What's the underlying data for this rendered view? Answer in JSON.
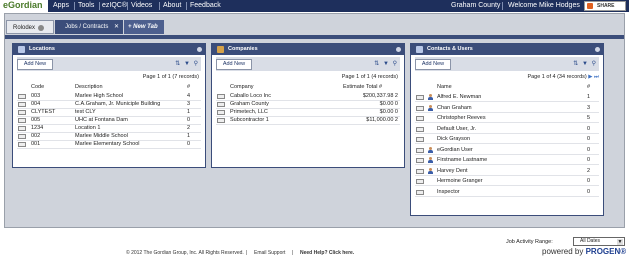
{
  "app": {
    "logo": "eGordian"
  },
  "nav": {
    "items": [
      "Apps",
      "Tools",
      "ezIQC®",
      "Videos",
      "About",
      "Feedback"
    ],
    "county": "Graham County",
    "welcome": "Welcome Mike Hodges",
    "share": "SHARE"
  },
  "tabs": {
    "rolodex": "Rolodex",
    "jobs": "Jobs / Contracts",
    "new_tab": "New Tab"
  },
  "locations": {
    "title": "Locations",
    "add_label": "Add New",
    "pager": "Page 1 of 1 (7 records)",
    "columns": [
      "Code",
      "Description",
      "#"
    ],
    "rows": [
      {
        "code": "003",
        "desc": "Marlee High School",
        "count": "4"
      },
      {
        "code": "004",
        "desc": "C.A.Graham, Jr. Municiple Building",
        "count": "3"
      },
      {
        "code": "CLYTEST",
        "desc": "test CLY",
        "count": "1"
      },
      {
        "code": "005",
        "desc": "UHC at Fontana Dam",
        "count": "0"
      },
      {
        "code": "1234",
        "desc": "Location 1",
        "count": "2"
      },
      {
        "code": "002",
        "desc": "Marlee Middle School",
        "count": "1"
      },
      {
        "code": "001",
        "desc": "Marlee Elementary School",
        "count": "0"
      }
    ]
  },
  "companies": {
    "title": "Companies",
    "add_label": "Add New",
    "pager": "Page 1 of 1 (4 records)",
    "columns": [
      "Company",
      "Estimate Total #"
    ],
    "rows": [
      {
        "name": "Caballo Loco Inc",
        "total": "$200,337.98 2"
      },
      {
        "name": "Graham County",
        "total": "$0.00 0"
      },
      {
        "name": "Primetech, LLC",
        "total": "$0.00 0"
      },
      {
        "name": "Subcontractor 1",
        "total": "$11,000.00 2"
      }
    ]
  },
  "contacts": {
    "title": "Contacts & Users",
    "add_label": "Add New",
    "pager": "Page 1 of 4 (34 records)",
    "columns": [
      "Name",
      "#"
    ],
    "rows": [
      {
        "name": "Alfred E. Newman",
        "count": "1",
        "person": true
      },
      {
        "name": "Chan Graham",
        "count": "3",
        "person": true
      },
      {
        "name": "Christopher Reeves",
        "count": "5",
        "person": false
      },
      {
        "name": "Default User, Jr.",
        "count": "0",
        "person": false
      },
      {
        "name": "Dick Grayson",
        "count": "0",
        "person": false
      },
      {
        "name": "eGordian User",
        "count": "0",
        "person": true
      },
      {
        "name": "Firstname Lastname",
        "count": "0",
        "person": true
      },
      {
        "name": "Harvey Dent",
        "count": "2",
        "person": true
      },
      {
        "name": "Hermoine Granger",
        "count": "0",
        "person": false
      },
      {
        "name": "Inspector",
        "count": "0",
        "person": false
      }
    ]
  },
  "footer": {
    "copyright": "© 2012 The Gordian Group, Inc. All Rights Reserved.",
    "email": "Email Support",
    "help": "Need Help? Click here.",
    "job_range_label": "Job Activity Range:",
    "job_range_value": "All Dates",
    "powered_prefix": "powered by",
    "powered_brand": "PROGEN®"
  }
}
